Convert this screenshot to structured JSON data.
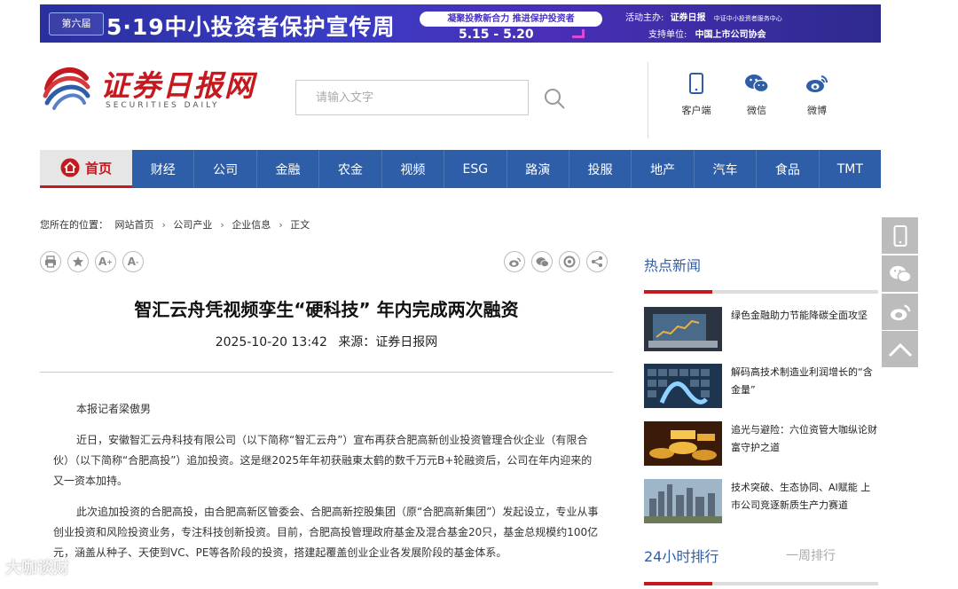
{
  "banner": {
    "edition": "第六届",
    "main_text": "5·19中小投资者保护宣传周",
    "slogan": "凝聚投教新合力 推进保护投资者",
    "dates": "5.15 - 5.20",
    "host_label": "活动主办:",
    "host_name": "证券日报",
    "host_org": "中证中小投资者服务中心",
    "support_label": "支持单位:",
    "support_name": "中国上市公司协会"
  },
  "header": {
    "logo_cn": "证券日报网",
    "logo_en": "SECURITIES DAILY",
    "search_placeholder": "请输入文字",
    "icons": [
      {
        "label": "客户端",
        "icon": "mobile-icon"
      },
      {
        "label": "微信",
        "icon": "wechat-icon"
      },
      {
        "label": "微博",
        "icon": "weibo-icon"
      }
    ]
  },
  "nav": {
    "home": "首页",
    "items": [
      "财经",
      "公司",
      "金融",
      "农金",
      "视频",
      "ESG",
      "路演",
      "投服",
      "地产",
      "汽车",
      "食品",
      "TMT"
    ]
  },
  "breadcrumb": {
    "label": "您所在的位置：",
    "items": [
      "网站首页",
      "公司产业",
      "企业信息",
      "正文"
    ]
  },
  "article": {
    "title": "智汇云舟凭视频孪生“硬科技” 年内完成两次融资",
    "date": "2025-10-20 13:42",
    "source_label": "来源：",
    "source": "证券日报网",
    "paragraphs": [
      "本报记者梁傲男",
      "近日，安徽智汇云舟科技有限公司（以下简称“智汇云舟”）宣布再获合肥高新创业投资管理合伙企业（有限合伙）（以下简称“合肥高投”）追加投资。这是继2025年年初获融東太鹤的数千万元B+轮融资后，公司在年内迎来的又一资本加持。",
      "此次追加投资的合肥高投，由合肥高新区管委会、合肥高新控股集团（原“合肥高新集团”）发起设立，专业从事创业投资和风险投资业务，专注科技创新投资。目前，合肥高投管理政府基金及混合基金20只，基金总规模约100亿元，涵盖从种子、天使到VC、PE等各阶段的投资，搭建起覆盖创业企业各发展阶段的基金体系。"
    ]
  },
  "sidebar": {
    "hot_title": "热点新闻",
    "news": [
      "绿色金融助力节能降碳全面攻坚",
      "解码高技术制造业利润增长的“含金量”",
      "追光与避险：六位资管大咖纵论财富守护之道",
      "技术突破、生态协同、AI赋能 上市公司竞逐新质生产力赛道"
    ],
    "tab_active": "24小时排行",
    "tab_inactive": "一周排行"
  },
  "watermark": "大咖谈财"
}
